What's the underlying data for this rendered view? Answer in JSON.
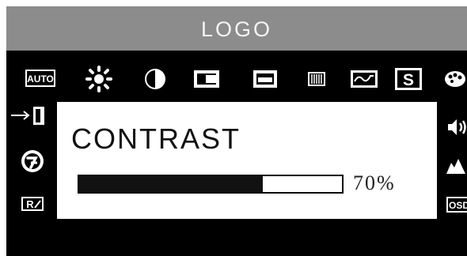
{
  "header": {
    "title": "LOGO"
  },
  "top_icons": [
    {
      "name": "auto-adjust-icon",
      "label": "AUTO"
    },
    {
      "name": "brightness-icon"
    },
    {
      "name": "contrast-icon"
    },
    {
      "name": "horizontal-position-icon"
    },
    {
      "name": "vertical-position-icon"
    },
    {
      "name": "phase-icon"
    },
    {
      "name": "clock-icon"
    },
    {
      "name": "sharpness-icon",
      "label": "S"
    },
    {
      "name": "color-icon"
    }
  ],
  "left_icons": [
    {
      "name": "exit-icon"
    },
    {
      "name": "language-icon"
    },
    {
      "name": "recall-icon",
      "label": "R"
    }
  ],
  "right_icons": [
    {
      "name": "volume-icon"
    },
    {
      "name": "mute-icon"
    },
    {
      "name": "osd-icon",
      "label": "OSD"
    }
  ],
  "panel": {
    "title": "CONTRAST",
    "value": 70,
    "value_text": "70%"
  },
  "colors": {
    "background": "#000000",
    "header": "#8c8c8c",
    "panel": "#ffffff",
    "bar_fill": "#111111"
  }
}
